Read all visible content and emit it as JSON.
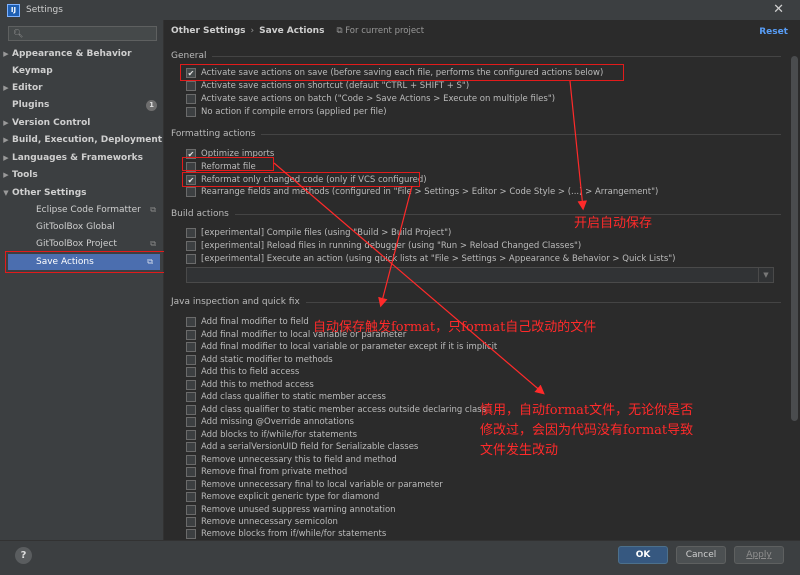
{
  "window": {
    "title": "Settings",
    "icon_label": "IJ"
  },
  "search": {
    "placeholder": ""
  },
  "sidebar": {
    "items": [
      {
        "label": "Appearance & Behavior",
        "expand": "▶"
      },
      {
        "label": "Keymap",
        "expand": ""
      },
      {
        "label": "Editor",
        "expand": "▶"
      },
      {
        "label": "Plugins",
        "expand": "",
        "badge": "1"
      },
      {
        "label": "Version Control",
        "expand": "▶"
      },
      {
        "label": "Build, Execution, Deployment",
        "expand": "▶"
      },
      {
        "label": "Languages & Frameworks",
        "expand": "▶"
      },
      {
        "label": "Tools",
        "expand": "▶"
      },
      {
        "label": "Other Settings",
        "expand": "▼"
      },
      {
        "label": "Eclipse Code Formatter",
        "expand": ""
      },
      {
        "label": "GitToolBox Global",
        "expand": ""
      },
      {
        "label": "GitToolBox Project",
        "expand": ""
      },
      {
        "label": "Save Actions",
        "expand": ""
      }
    ]
  },
  "header": {
    "crumb1": "Other Settings",
    "sep": "›",
    "crumb2": "Save Actions",
    "project_note": "For current project",
    "reset_label": "Reset"
  },
  "groups": {
    "general": "General",
    "formatting": "Formatting actions",
    "build": "Build actions",
    "java": "Java inspection and quick fix"
  },
  "general_options": [
    {
      "label": "Activate save actions on save (before saving each file, performs the configured actions below)",
      "checked": true
    },
    {
      "label": "Activate save actions on shortcut (default \"CTRL + SHIFT + S\")",
      "checked": false
    },
    {
      "label": "Activate save actions on batch (\"Code > Save Actions > Execute on multiple files\")",
      "checked": false
    },
    {
      "label": "No action if compile errors (applied per file)",
      "checked": false
    }
  ],
  "formatting_options": [
    {
      "label": "Optimize imports",
      "checked": true
    },
    {
      "label": "Reformat file",
      "checked": false
    },
    {
      "label": "Reformat only changed code (only if VCS configured)",
      "checked": true
    },
    {
      "label": "Rearrange fields and methods (configured in \"File > Settings > Editor > Code Style > (...) > Arrangement\")",
      "checked": false
    }
  ],
  "build_options": [
    {
      "label": "[experimental] Compile files (using \"Build > Build Project\")",
      "checked": false
    },
    {
      "label": "[experimental] Reload files in running debugger (using \"Run > Reload Changed Classes\")",
      "checked": false
    },
    {
      "label": "[experimental] Execute an action (using quick lists at \"File > Settings > Appearance & Behavior > Quick Lists\")",
      "checked": false
    }
  ],
  "java_options": [
    {
      "label": "Add final modifier to field",
      "checked": false
    },
    {
      "label": "Add final modifier to local variable or parameter",
      "checked": false
    },
    {
      "label": "Add final modifier to local variable or parameter except if it is implicit",
      "checked": false
    },
    {
      "label": "Add static modifier to methods",
      "checked": false
    },
    {
      "label": "Add this to field access",
      "checked": false
    },
    {
      "label": "Add this to method access",
      "checked": false
    },
    {
      "label": "Add class qualifier to static member access",
      "checked": false
    },
    {
      "label": "Add class qualifier to static member access outside declaring class",
      "checked": false
    },
    {
      "label": "Add missing @Override annotations",
      "checked": false
    },
    {
      "label": "Add blocks to if/while/for statements",
      "checked": false
    },
    {
      "label": "Add a serialVersionUID field for Serializable classes",
      "checked": false
    },
    {
      "label": "Remove unnecessary this to field and method",
      "checked": false
    },
    {
      "label": "Remove final from private method",
      "checked": false
    },
    {
      "label": "Remove unnecessary final to local variable or parameter",
      "checked": false
    },
    {
      "label": "Remove explicit generic type for diamond",
      "checked": false
    },
    {
      "label": "Remove unused suppress warning annotation",
      "checked": false
    },
    {
      "label": "Remove unnecessary semicolon",
      "checked": false
    },
    {
      "label": "Remove blocks from if/while/for statements",
      "checked": false
    }
  ],
  "annotations": {
    "enable_autosave": "开启自动保存",
    "format_changed": "自动保存触发format，只format自己改动的文件",
    "caution_line1": "慎用，自动format文件，无论你是否",
    "caution_line2": "修改过，会因为代码没有format导致",
    "caution_line3": "文件发生改动"
  },
  "footer": {
    "help": "?",
    "ok": "OK",
    "cancel": "Cancel",
    "apply": "Apply"
  },
  "colors": {
    "accent": "#4b6eaf",
    "annotation": "#ff2a2a",
    "link": "#589df6"
  },
  "icons": {
    "search": "search-icon",
    "close": "close-icon",
    "copy": "copy-project-icon",
    "help": "help-icon"
  }
}
